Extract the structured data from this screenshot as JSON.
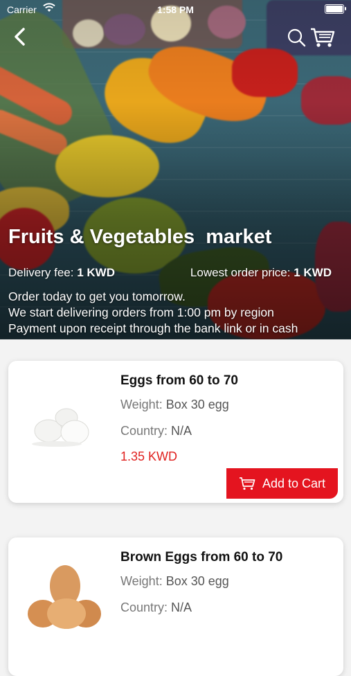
{
  "status_bar": {
    "carrier": "Carrier",
    "time": "1:58 PM"
  },
  "header": {
    "title": "Fruits & Vegetables  market",
    "delivery_fee_label": "Delivery fee: ",
    "delivery_fee_value": "1 KWD",
    "lowest_order_label": "Lowest order price: ",
    "lowest_order_value": "1 KWD",
    "info_lines": [
      "Order today to get you tomorrow.",
      "We start delivering orders from 1:00 pm by region",
      "Payment upon receipt through the bank link or in cash"
    ]
  },
  "icons": {
    "back": "back-arrow-icon",
    "search": "search-icon",
    "cart": "cart-icon"
  },
  "products": [
    {
      "name": "Eggs from 60 to 70",
      "weight_label": "Weight: ",
      "weight_value": "Box 30 egg",
      "country_label": "Country: ",
      "country_value": "N/A",
      "price": "1.35 KWD",
      "button_label": "Add to Cart"
    },
    {
      "name": "Brown Eggs from 60 to 70",
      "weight_label": "Weight: ",
      "weight_value": "Box 30 egg",
      "country_label": "Country: ",
      "country_value": "N/A"
    }
  ],
  "colors": {
    "accent": "#e4141f",
    "price": "#e0201e"
  }
}
